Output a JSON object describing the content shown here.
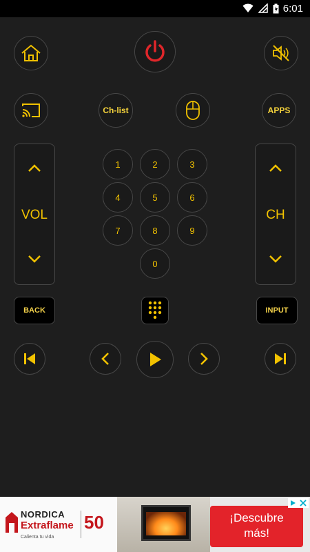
{
  "status_bar": {
    "time": "6:01"
  },
  "remote": {
    "accent_color": "#f2c200",
    "power_color": "#e0262a",
    "top_row": {
      "home": "home-icon",
      "power": "power-icon",
      "mute": "mute-icon"
    },
    "second_row": {
      "cast": "cast-icon",
      "ch_list_label": "Ch-list",
      "mouse": "mouse-icon",
      "apps_label": "APPS"
    },
    "volume": {
      "label": "VOL",
      "up": "chevron-up-icon",
      "down": "chevron-down-icon"
    },
    "channel": {
      "label": "CH",
      "up": "chevron-up-icon",
      "down": "chevron-down-icon"
    },
    "keypad": [
      "1",
      "2",
      "3",
      "4",
      "5",
      "6",
      "7",
      "8",
      "9",
      "0"
    ],
    "back_label": "BACK",
    "input_label": "INPUT",
    "numpad_toggle": "dialpad-icon",
    "transport": [
      "skip-previous-icon",
      "chevron-left-icon",
      "play-icon",
      "chevron-right-icon",
      "skip-next-icon"
    ]
  },
  "ad": {
    "brand_line1": "NORDICA",
    "brand_line2": "Extraflame",
    "tagline": "Calienta tu vida",
    "anniversary": "50",
    "cta_line1": "¡Descubre",
    "cta_line2": "más!"
  }
}
